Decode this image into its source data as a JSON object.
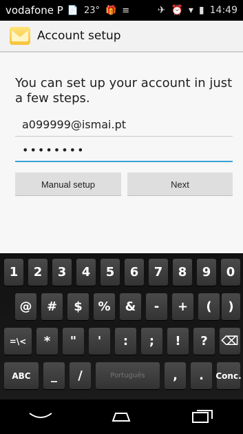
{
  "status": {
    "carrier": "vodafone P",
    "notif_icons": [
      "📄",
      "23°",
      "🎁",
      "≡"
    ],
    "right_icons": [
      "✈",
      "⏰",
      "▾",
      "▮"
    ],
    "time": "14:49"
  },
  "actionbar": {
    "title": "Account setup",
    "icon": "email-app-icon"
  },
  "form": {
    "intro": "You can set up your account in just a few steps.",
    "email_value": "a099999@ismai.pt",
    "password_value": "••••••••",
    "manual_label": "Manual setup",
    "next_label": "Next"
  },
  "keyboard": {
    "row1": [
      "1",
      "2",
      "3",
      "4",
      "5",
      "6",
      "7",
      "8",
      "9",
      "0"
    ],
    "row2": [
      "@",
      "#",
      "$",
      "%",
      "&",
      "-",
      "+",
      "(",
      ")"
    ],
    "row3": [
      "=\\<",
      "*",
      "\"",
      "'",
      ":",
      ";",
      "!",
      "?",
      "⌫"
    ],
    "row4": [
      "ABC",
      "_",
      "/",
      "Português",
      ",",
      ".",
      "Conc."
    ]
  },
  "navbar": {
    "back_icon": "back-icon",
    "home_icon": "home-icon",
    "recents_icon": "recents-icon"
  }
}
